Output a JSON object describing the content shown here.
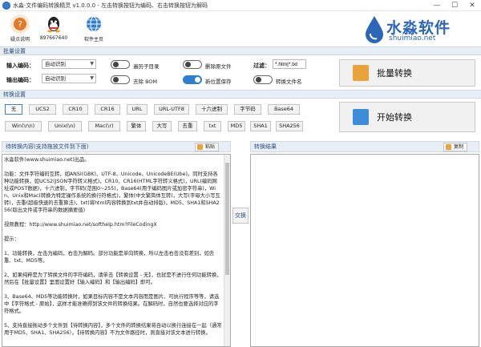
{
  "window": {
    "title": "水淼·文件编码转换精灵 v1.0.0.0 - 左击转换按钮为编码、右击转换按钮为解码",
    "minimize": "—",
    "maximize": "☐",
    "close": "✕"
  },
  "toolbar": {
    "items": [
      {
        "label": "疑点说明",
        "icon": "help-icon",
        "color": "#e07a2b"
      },
      {
        "label": "897667640",
        "icon": "qq-icon",
        "color": "#222222"
      },
      {
        "label": "软件主页",
        "icon": "home-icon",
        "color": "#2f7fd0"
      }
    ]
  },
  "logo": {
    "cn": "水淼软件",
    "en": "shuimiao.net"
  },
  "batch": {
    "section_title": "批量设置",
    "input_encoding_label": "输入编码：",
    "input_encoding_value": "自动识别",
    "output_encoding_label": "输出编码：",
    "output_encoding_value": "自动识别",
    "toggles": [
      {
        "label": "遍历子目录",
        "on": false
      },
      {
        "label": "删除原文件",
        "on": false
      },
      {
        "label": "去除 BOM",
        "on": false
      },
      {
        "label": "新位置保存",
        "on": true
      },
      {
        "label": "转换文件名",
        "on": false
      }
    ],
    "filter_label": "过滤：",
    "filter_value": "*.htm|*.txt",
    "batch_button": "批量转换"
  },
  "convert": {
    "section_title": "转换设置",
    "row1": [
      "无",
      "UCS2",
      "CR10",
      "CR16",
      "URL",
      "URL-UTF8",
      "十六进制",
      "字节码",
      "Base64"
    ],
    "row2": [
      "Win(\\r\\n)",
      "Unix(\\n)",
      "Mac(\\r)",
      "繁体",
      "大写",
      "去重",
      "txt",
      "MD5",
      "SHA1",
      "SHA256"
    ],
    "start_button": "开始转换"
  },
  "left_panel": {
    "title": "待转换内容(支持拖放文件到下面)",
    "paste_button": "粘贴",
    "content": "水淼软件(www.shuimiao.net)出品。\n\n功能：文件字符编码互转，如ANSI(GBK)、UTF-8、Unicode、UnicodeBE(Ube)。同时支持各种功能转换，如UCS2(JSON字符转义格式)，CR10、CR16(HTML字符转义格式)，URL(编码网址或POST数据)，十六进制，字节码(范围0~255)，Base64(用于编码图片或加密字符串)，Win、Unix和Mac(转换为特定操作系统的换行符格式)，繁体(中文繁简体互转)，大写(字母大小写互转)，去重(超级快速的去重算法)，txt(将html内容转换到txt并自动排版)，MD5、SHA1和SHA256(取出文件或字符串的数据摘要值)\n\n视频教程：http://www.shuimiao.net/softhelp.htm?FileCodingX\n\n提示：\n\n1、功能转换，左击为编码，右击为解码。部分功能是单向转换，所以左击右击没有差别，如去重、txt、MD5等。\n\n2、如果纯粹是为了转换文件的字符编码，请单击【转换设置 - 无】，也就是不进行任何功能转换，然后在【批量设置】里面设置好【输入编码】和【输出编码】即可。\n\n3、Base64、MD5等功能转换时，如果目标内容不是文本内容而是图片、可执行程序等等，请选中【字符格式 - 原始】，这样才能准确得到该文件的转换结果。在解码时，自然也要选择对应的字符格式。\n\n5、支持直接拖动多个文件到【待转换内容】，多个文件的转换结果将自动以换行连接在一起（通常用于MD5、SHA1、SHA256）。【待转换内容】不为文件路径时，则直接对该文本进行转换。"
  },
  "swap_button": "交换",
  "right_panel": {
    "title": "转换结果",
    "copy_button": "复制",
    "content": ""
  }
}
